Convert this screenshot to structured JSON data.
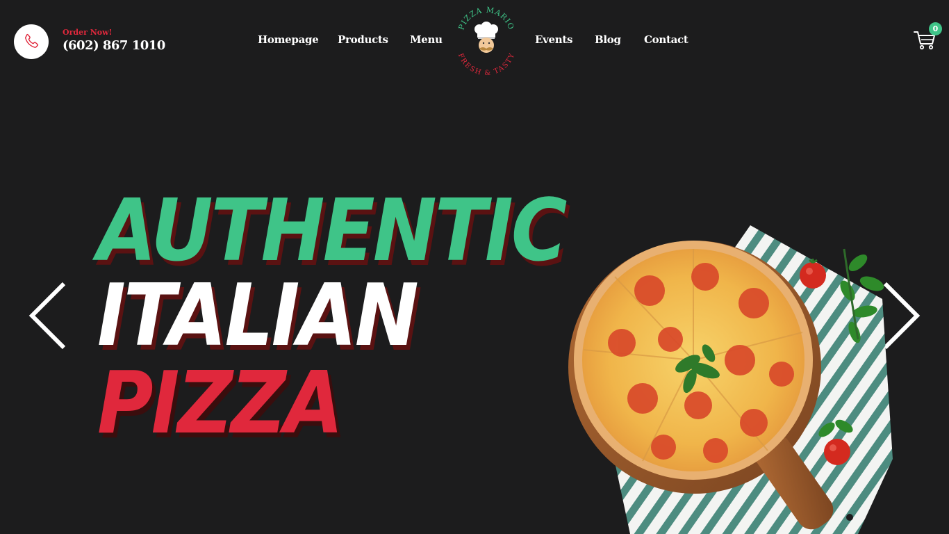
{
  "header": {
    "order_label": "Order Now!",
    "phone": "(602) 867 1010",
    "phone_icon": "phone-icon",
    "nav": {
      "homepage": "Homepage",
      "products": "Products",
      "menu": "Menu",
      "events": "Events",
      "blog": "Blog",
      "contact": "Contact"
    },
    "logo": {
      "top_text": "PIZZA MARIO",
      "bottom_text": "FRESH & TASTY",
      "icon": "chef-icon"
    },
    "cart": {
      "icon": "cart-icon",
      "count": "0"
    }
  },
  "hero": {
    "line1": "AUTHENTIC",
    "line2": "ITALIAN",
    "line3": "PIZZA",
    "prev_icon": "chevron-left-icon",
    "next_icon": "chevron-right-icon",
    "image": "pizza-image"
  },
  "colors": {
    "background": "#1c1c1d",
    "accent_green": "#3fc488",
    "accent_red": "#e0283c",
    "text_shadow": "#5a1212",
    "white": "#ffffff"
  }
}
